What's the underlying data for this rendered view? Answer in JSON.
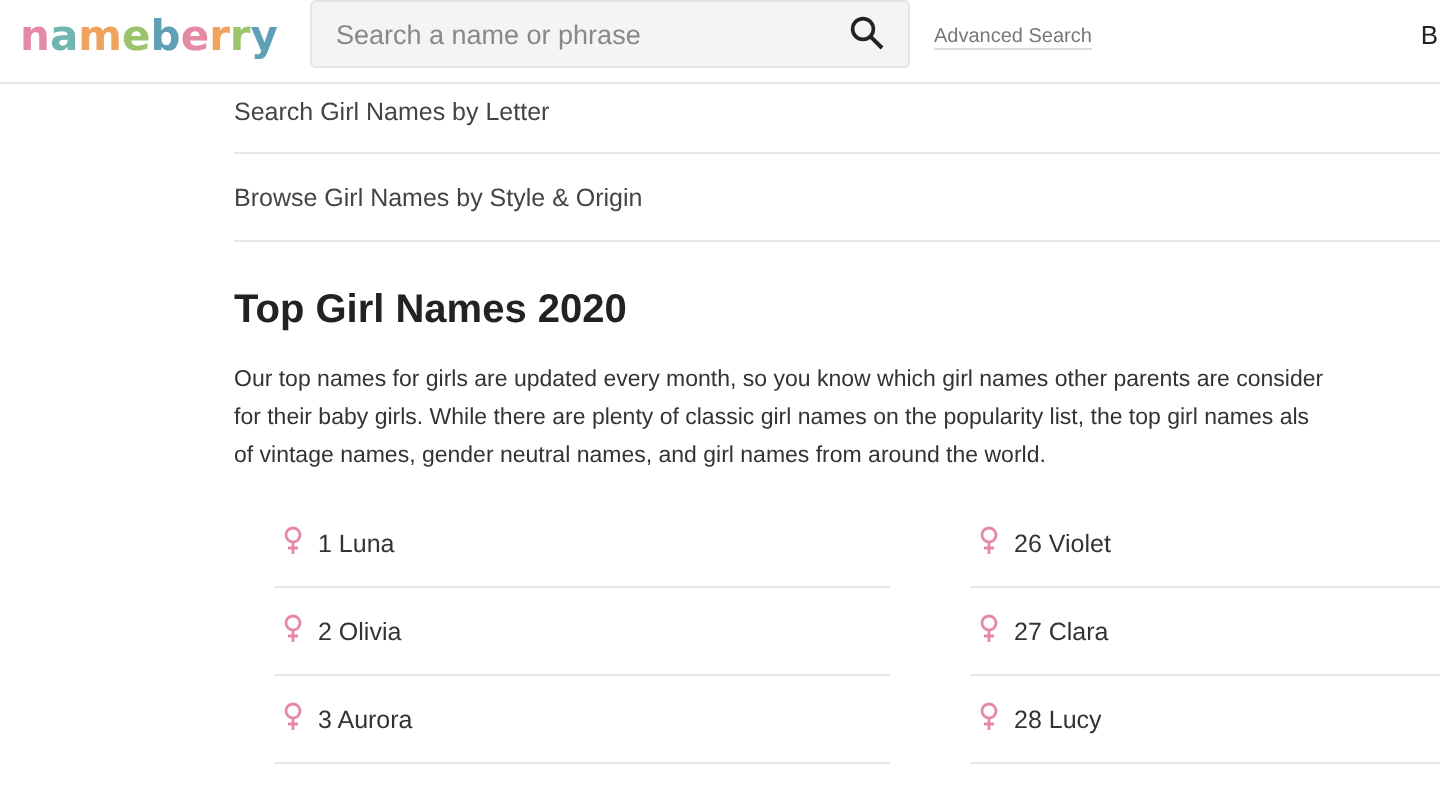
{
  "header": {
    "logo": "nameberry",
    "search": {
      "placeholder": "Search a name or phrase"
    },
    "advanced_link": "Advanced Search",
    "cut_item": "B"
  },
  "links": [
    "Search Girl Names by Letter",
    "Browse Girl Names by Style & Origin"
  ],
  "heading": "Top Girl Names 2020",
  "intro_lines": [
    "Our top names for girls are updated every month, so you know which girl names other parents are consider",
    "for their baby girls. While there are plenty of classic girl names on the popularity list, the top girl names als",
    "of vintage names, gender neutral names, and girl names from around the world."
  ],
  "names": [
    {
      "label": "1 Luna"
    },
    {
      "label": "2 Olivia"
    },
    {
      "label": "3 Aurora"
    },
    {
      "label": "26 Violet"
    },
    {
      "label": "27 Clara"
    },
    {
      "label": "28 Lucy"
    }
  ]
}
